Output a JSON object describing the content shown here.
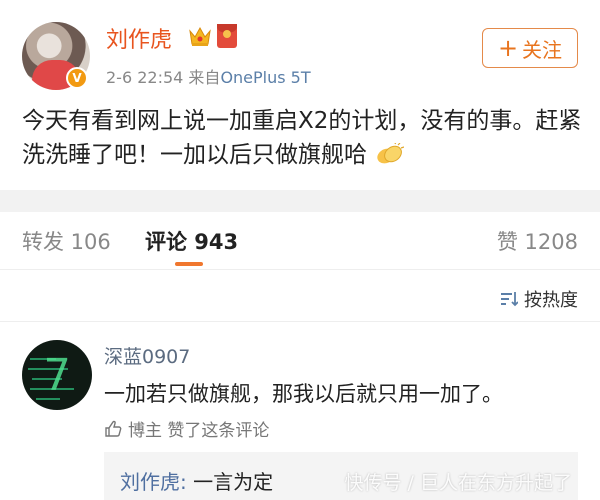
{
  "post": {
    "username": "刘作虎",
    "verified_badge": "V",
    "time": "2-6 22:54",
    "source_prefix": "来自",
    "source": "OnePlus 5T",
    "follow_plus": "+",
    "follow_label": "关注",
    "text": "今天有看到网上说一加重启X2的计划，没有的事。赶紧洗洗睡了吧！一加以后只做旗舰哈",
    "icons": [
      "avatar",
      "vip-crown-icon",
      "red-packet-icon",
      "clap-emoji-icon"
    ]
  },
  "tabs": {
    "repost": "转发 106",
    "comment": "评论 943",
    "like": "赞 1208"
  },
  "sort": {
    "label": "按热度",
    "icon": "sort-icon"
  },
  "comment": {
    "username": "深蓝0907",
    "text": "一加若只做旗舰，那我以后就只用一加了。",
    "liked_by_author": "博主 赞了这条评论",
    "reply": {
      "username": "刘作虎:",
      "text": " 一言为定"
    }
  },
  "watermark": "快传号 / 巨人在东方升起了",
  "colors": {
    "username": "#e8541e",
    "follow_border": "#e48a4a",
    "tab_underline": "#f0772e",
    "link": "#5b7fa8"
  }
}
